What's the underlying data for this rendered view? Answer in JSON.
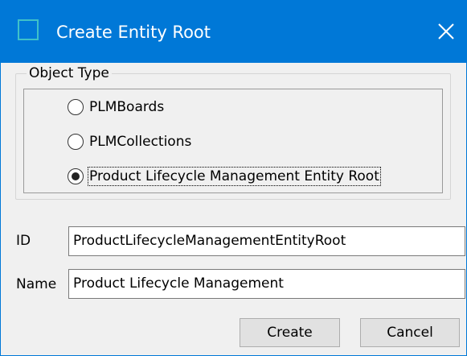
{
  "window": {
    "title": "Create Entity Root",
    "close_glyph": "✕"
  },
  "colors": {
    "titlebar": "#0078d7",
    "window_bg": "#f0f0f0",
    "button_bg": "#e1e1e1"
  },
  "object_type": {
    "legend": "Object Type",
    "options": [
      {
        "label": "PLMBoards",
        "checked": false
      },
      {
        "label": "PLMCollections",
        "checked": false
      },
      {
        "label": "Product Lifecycle Management Entity Root",
        "checked": true
      }
    ]
  },
  "fields": {
    "id_label": "ID",
    "id_value": "ProductLifecycleManagementEntityRoot",
    "name_label": "Name",
    "name_value": "Product Lifecycle Management"
  },
  "buttons": {
    "create_label": "Create",
    "cancel_label": "Cancel"
  }
}
